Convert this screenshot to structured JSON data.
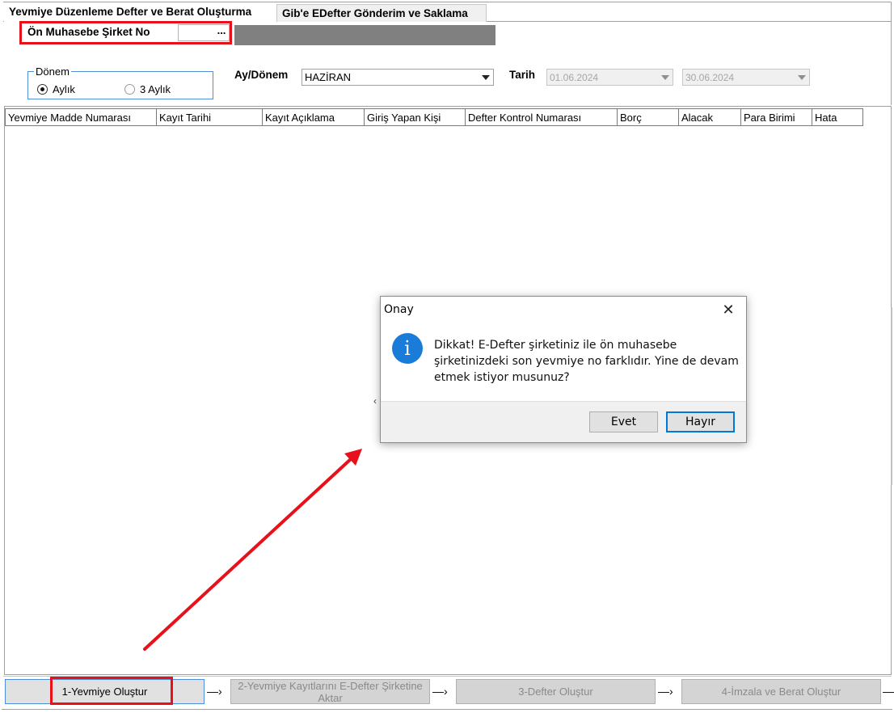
{
  "tabs": [
    {
      "label": "Yevmiye Düzenleme  Defter ve Berat Oluşturma",
      "active": true
    },
    {
      "label": "Gib'e EDefter Gönderim ve Saklama",
      "active": false
    }
  ],
  "company": {
    "label": "Ön Muhasebe Şirket No",
    "value": "",
    "browse_label": "..."
  },
  "period": {
    "group_label": "Dönem",
    "options": [
      {
        "label": "Aylık",
        "selected": true
      },
      {
        "label": "3 Aylık",
        "selected": false
      }
    ]
  },
  "month": {
    "label": "Ay/Dönem",
    "value": "HAZİRAN"
  },
  "date": {
    "label": "Tarih",
    "start": "01.06.2024",
    "end": "30.06.2024"
  },
  "grid": {
    "columns": [
      "Yevmiye Madde Numarası",
      "Kayıt Tarihi",
      "Kayıt Açıklama",
      "Giriş Yapan Kişi",
      "Defter Kontrol Numarası",
      "Borç",
      "Alacak",
      "Para Birimi",
      "Hata"
    ],
    "rows": []
  },
  "dialog": {
    "title": "Onay",
    "icon": "info-icon",
    "message": "Dikkat! E-Defter şirketiniz ile ön muhasebe şirketinizdeki son yevmiye no farklıdır. Yine de devam etmek istiyor musunuz?",
    "buttons": {
      "yes": "Evet",
      "no": "Hayır"
    }
  },
  "steps": [
    {
      "label": "1-Yevmiye Oluştur",
      "enabled": true
    },
    {
      "label": "2-Yevmiye Kayıtlarını E-Defter Şirketine Aktar",
      "enabled": false
    },
    {
      "label": "3-Defter Oluştur",
      "enabled": false
    },
    {
      "label": "4-İmzala ve Berat Oluştur",
      "enabled": false
    }
  ],
  "colors": {
    "highlight": "#e8101a",
    "accent": "#0078d7",
    "info_icon": "#1b7bd9"
  }
}
